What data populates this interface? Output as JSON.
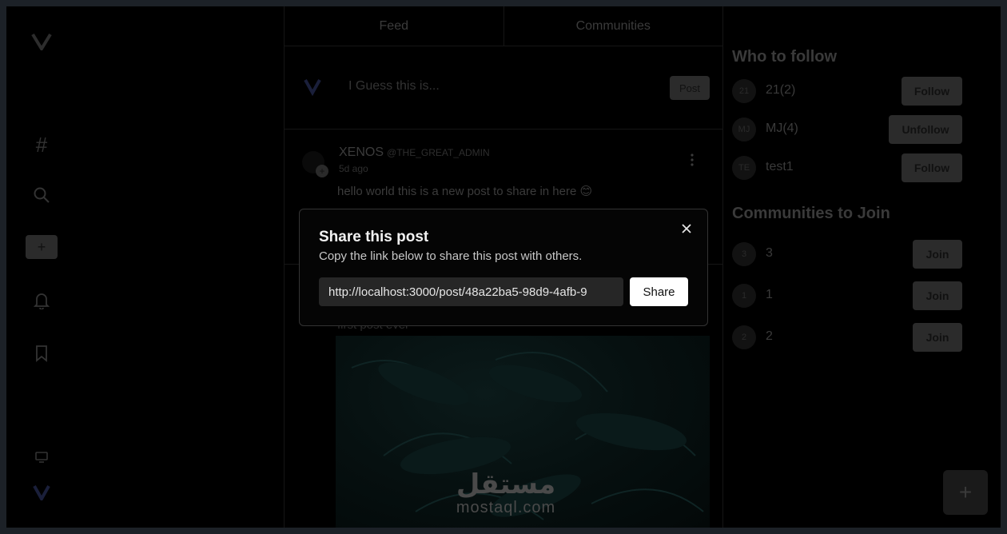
{
  "tabs": [
    {
      "label": "Feed"
    },
    {
      "label": "Communities"
    }
  ],
  "composer": {
    "placeholder": "I Guess this is...",
    "post_label": "Post"
  },
  "posts": [
    {
      "author": "XENOS",
      "handle": "@THE_GREAT_ADMIN",
      "time": "5d ago",
      "text": "hello world this is a new post to share in here 😊"
    },
    {
      "text": "first post ever"
    }
  ],
  "who_to_follow": {
    "title": "Who to follow",
    "items": [
      {
        "initials": "21",
        "name": "21(2)",
        "action": "Follow"
      },
      {
        "initials": "MJ",
        "name": "MJ(4)",
        "action": "Unfollow"
      },
      {
        "initials": "TE",
        "name": "test1",
        "action": "Follow"
      }
    ]
  },
  "communities": {
    "title": "Communities to Join",
    "items": [
      {
        "initials": "3",
        "name": "3",
        "action": "Join"
      },
      {
        "initials": "1",
        "name": "1",
        "action": "Join"
      },
      {
        "initials": "2",
        "name": "2",
        "action": "Join"
      }
    ]
  },
  "modal": {
    "title": "Share this post",
    "subtitle": "Copy the link below to share this post with others.",
    "link": "http://localhost:3000/post/48a22ba5-98d9-4afb-9",
    "share_label": "Share",
    "close_icon": "close-icon"
  },
  "fab": {
    "label": "+"
  },
  "watermark": {
    "arabic": "مستقل",
    "latin": "mostaql.com"
  },
  "colors": {
    "modal_bg": "#050505",
    "overlay": "#000000",
    "button_white": "#ffffff"
  }
}
